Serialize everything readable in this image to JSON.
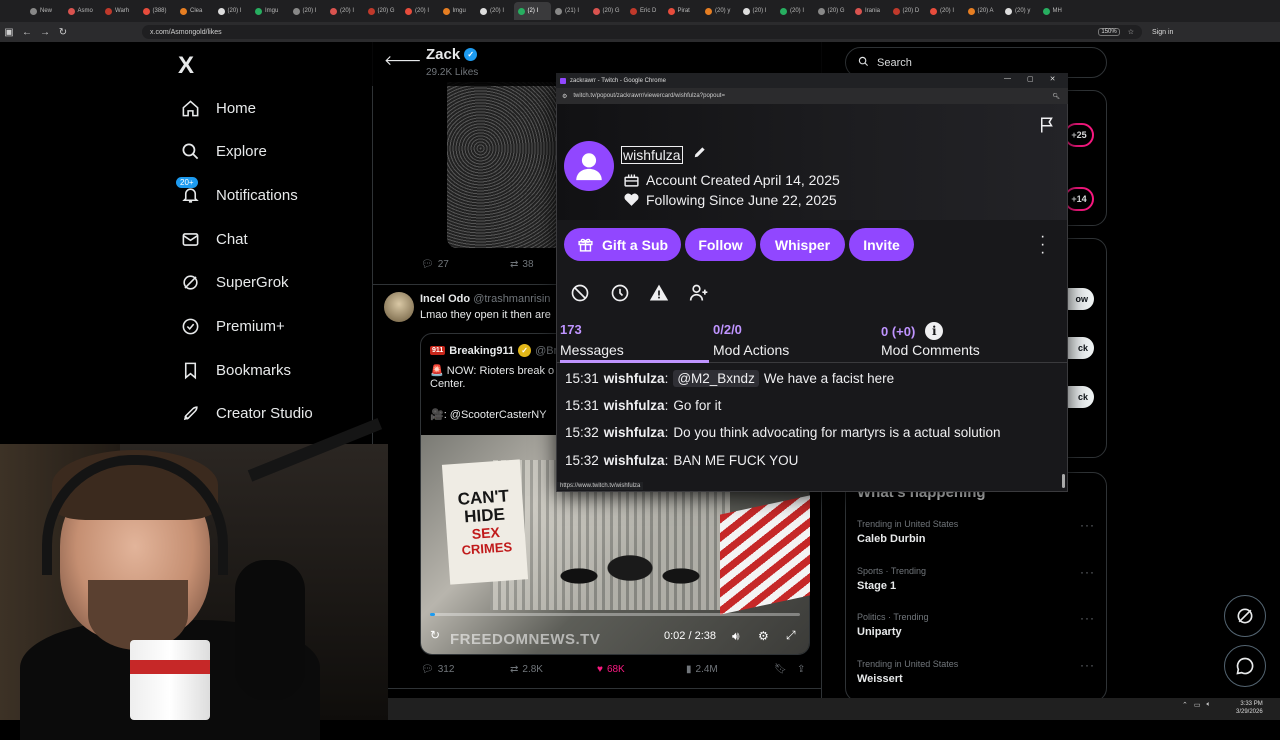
{
  "browser": {
    "tabs": [
      "New",
      "Asmo",
      "Warh",
      "(388)",
      "Clea",
      "(20) I",
      "Imgu",
      "(20) I",
      "(20) I",
      "(20) G",
      "(20) I",
      "Imgu",
      "(20) I",
      "(2) I",
      "(21) I",
      "(20) G",
      "Eric D",
      "Pirat",
      "(20) y",
      "(20) I",
      "(20) I",
      "(20) G",
      "Irania",
      "(20) D",
      "(20) I",
      "(20) A",
      "(20) y",
      "MH"
    ],
    "active_tab_index": 13,
    "url": "x.com/Asmongold/likes",
    "zoom": "150%",
    "signin": "Sign in"
  },
  "x_nav": {
    "logo": "X",
    "items": [
      {
        "label": "Home",
        "icon": "home-icon"
      },
      {
        "label": "Explore",
        "icon": "search-icon"
      },
      {
        "label": "Notifications",
        "icon": "bell-icon",
        "badge": "20+"
      },
      {
        "label": "Chat",
        "icon": "mail-icon"
      },
      {
        "label": "SuperGrok",
        "icon": "grok-icon"
      },
      {
        "label": "Premium+",
        "icon": "premium-icon"
      },
      {
        "label": "Bookmarks",
        "icon": "bookmark-icon"
      },
      {
        "label": "Creator Studio",
        "icon": "rocket-icon"
      }
    ]
  },
  "profile_header": {
    "name": "Zack",
    "likes": "29.2K Likes"
  },
  "tweet1_actions": {
    "replies": "27",
    "retweets": "38"
  },
  "tweet2": {
    "name": "Incel Odo",
    "handle": "@trashmanrisin",
    "text": "Lmao they open it then are",
    "quote": {
      "name": "Breaking911",
      "handle": "@Br",
      "line1": "🚨 NOW: Rioters break o",
      "line2": "Center.",
      "line3": "🎥: @ScooterCasterNY",
      "video": {
        "sign_line1": "CAN'T",
        "sign_line2": "HIDE",
        "sign_line3": "SEX",
        "sign_line4": "CRIMES",
        "watermark": "FREEDOMNEWS.TV",
        "time": "0:02 / 2:38",
        "progress": 0.013
      }
    },
    "actions": {
      "replies": "312",
      "retweets": "2.8K",
      "likes": "68K",
      "views": "2.4M"
    }
  },
  "right_col": {
    "search_placeholder": "Search",
    "pill1": "+25",
    "pill2": "+14",
    "btn1": "ow",
    "btn2": "ck",
    "btn3": "ck",
    "whats_happening": "What's happening",
    "trends": [
      {
        "meta": "Trending in United States",
        "title": "Caleb Durbin"
      },
      {
        "meta": "Sports · Trending",
        "title": "Stage 1"
      },
      {
        "meta": "Politics · Trending",
        "title": "Uniparty"
      },
      {
        "meta": "Trending in United States",
        "title": "Weissert"
      }
    ]
  },
  "popout": {
    "window_title": "zackrawrr - Twitch - Google Chrome",
    "url": "twitch.tv/popout/zackrawrr/viewercard/wishfulza?popout=",
    "username": "wishfulza",
    "account_created": "Account Created April 14, 2025",
    "following_since": "Following Since June 22, 2025",
    "buttons": {
      "gift": "Gift a Sub",
      "follow": "Follow",
      "whisper": "Whisper",
      "invite": "Invite"
    },
    "stats": [
      {
        "num": "173",
        "label": "Messages"
      },
      {
        "num": "0/2/0",
        "label": "Mod Actions"
      },
      {
        "num": "0 (+0)",
        "label": "Mod Comments"
      }
    ],
    "messages": [
      {
        "time": "15:31",
        "user": "wishfulza",
        "mention": "@M2_Bxndz",
        "text": "We have a facist here"
      },
      {
        "time": "15:31",
        "user": "wishfulza",
        "mention": "",
        "text": "Go for it"
      },
      {
        "time": "15:32",
        "user": "wishfulza",
        "mention": "",
        "text": "Do you think advocating for martyrs is a actual solution"
      },
      {
        "time": "15:32",
        "user": "wishfulza",
        "mention": "",
        "text": "BAN ME FUCK YOU"
      }
    ],
    "status_url": "https://www.twitch.tv/wishfulza"
  },
  "taskbar": {
    "time": "3:33 PM",
    "date": "3/29/2026"
  },
  "colors": {
    "twitch_purple": "#9147ff",
    "twitch_light_purple": "#bf94ff",
    "x_blue": "#1d9bf0",
    "x_pink": "#f91880"
  }
}
